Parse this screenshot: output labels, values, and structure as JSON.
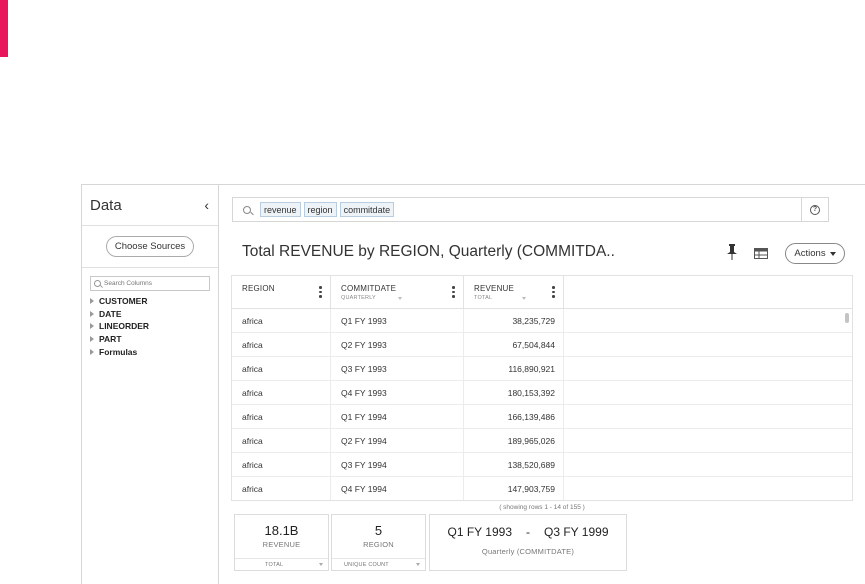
{
  "sidebar": {
    "title": "Data",
    "collapse_icon": "‹",
    "choose_sources_label": "Choose Sources",
    "search_placeholder": "Search Columns",
    "tree": [
      {
        "label": "CUSTOMER"
      },
      {
        "label": "DATE"
      },
      {
        "label": "LINEORDER"
      },
      {
        "label": "PART"
      },
      {
        "label": "Formulas"
      }
    ]
  },
  "search": {
    "tokens": [
      "revenue",
      "region",
      "commitdate"
    ],
    "help_icon": "?"
  },
  "answer": {
    "title": "Total REVENUE by REGION, Quarterly (COMMITDA..",
    "actions_label": "Actions"
  },
  "table": {
    "columns": [
      {
        "name": "REGION",
        "sub": ""
      },
      {
        "name": "COMMITDATE",
        "sub": "QUARTERLY"
      },
      {
        "name": "REVENUE",
        "sub": "TOTAL"
      }
    ],
    "rows": [
      [
        "africa",
        "Q1 FY 1993",
        "38,235,729"
      ],
      [
        "africa",
        "Q2 FY 1993",
        "67,504,844"
      ],
      [
        "africa",
        "Q3 FY 1993",
        "116,890,921"
      ],
      [
        "africa",
        "Q4 FY 1993",
        "180,153,392"
      ],
      [
        "africa",
        "Q1 FY 1994",
        "166,139,486"
      ],
      [
        "africa",
        "Q2 FY 1994",
        "189,965,026"
      ],
      [
        "africa",
        "Q3 FY 1994",
        "138,520,689"
      ],
      [
        "africa",
        "Q4 FY 1994",
        "147,903,759"
      ]
    ],
    "showing_text": "( showing rows 1 - 14 of 155 )"
  },
  "summary": {
    "revenue": {
      "value": "18.1B",
      "label": "REVENUE",
      "footer": "TOTAL"
    },
    "region": {
      "value": "5",
      "label": "REGION",
      "footer": "UNIQUE COUNT"
    },
    "commitdate": {
      "from": "Q1 FY 1993",
      "sep": "-",
      "to": "Q3 FY 1999",
      "label": "Quarterly (COMMITDATE)"
    }
  },
  "colors": {
    "accent": "#e8175d",
    "token_bg": "#eef3f8",
    "token_border": "#b9cde0"
  }
}
